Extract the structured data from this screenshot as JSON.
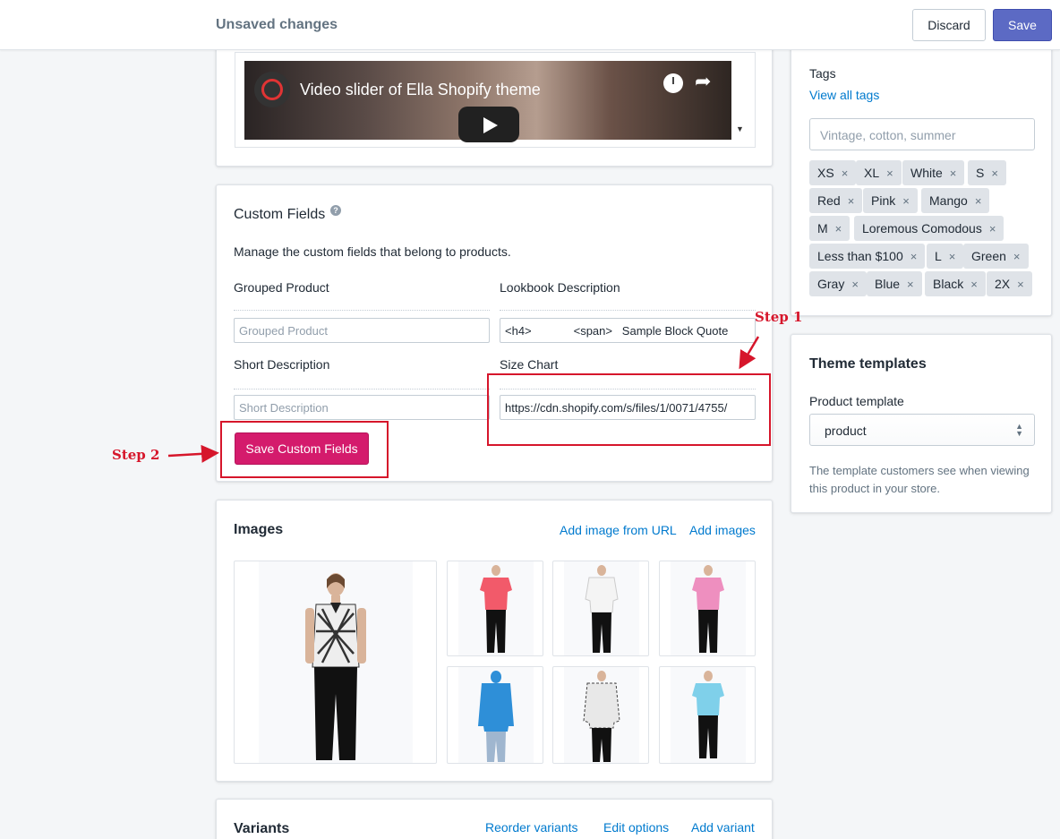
{
  "topbar": {
    "title": "Unsaved changes",
    "discard_label": "Discard",
    "save_label": "Save"
  },
  "video": {
    "title": "Video slider of Ella Shopify theme"
  },
  "custom_fields": {
    "title": "Custom Fields",
    "help_glyph": "?",
    "description": "Manage the custom fields that belong to products.",
    "grouped_product": {
      "label": "Grouped Product",
      "placeholder": "Grouped Product"
    },
    "lookbook_description": {
      "label": "Lookbook Description",
      "value": "<h4>             <span>   Sample Block Quote"
    },
    "short_description": {
      "label": "Short Description",
      "placeholder": "Short Description"
    },
    "size_chart": {
      "label": "Size Chart",
      "value": "https://cdn.shopify.com/s/files/1/0071/4755/"
    },
    "save_label": "Save Custom Fields"
  },
  "images": {
    "title": "Images",
    "add_from_url": "Add image from URL",
    "add_images": "Add images",
    "shirt_colors": [
      "#f25a6a",
      "#f4f4f4",
      "#ee8fbf",
      "#2e8fd8",
      "#e8e8e8",
      "#7fd0ea"
    ]
  },
  "variants": {
    "title": "Variants",
    "reorder": "Reorder variants",
    "edit_options": "Edit options",
    "add_variant": "Add variant"
  },
  "tags": {
    "label": "Tags",
    "view_all": "View all tags",
    "placeholder": "Vintage, cotton, summer",
    "items": [
      "XS",
      "XL",
      "White",
      "S",
      "Red",
      "Pink",
      "Mango",
      "M",
      "Loremous Comodous",
      "Less than $100",
      "L",
      "Green",
      "Gray",
      "Blue",
      "Black",
      "2X"
    ],
    "remove_glyph": "×"
  },
  "theme_templates": {
    "title": "Theme templates",
    "label": "Product template",
    "selected": "product",
    "help": "The template customers see when viewing this product in your store."
  },
  "annotations": {
    "step1": "Step 1",
    "step2": "Step 2",
    "color": "#d6162b"
  }
}
